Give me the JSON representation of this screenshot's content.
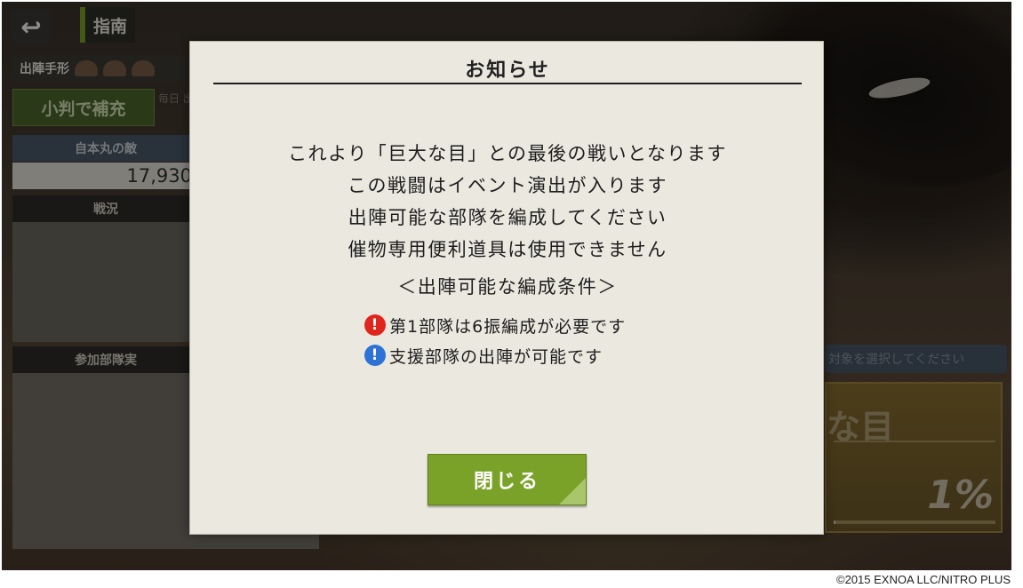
{
  "hud": {
    "back_icon": "↩",
    "guide_label": "指南",
    "tegata_label": "出陣手形",
    "refill_label": "小判で補充",
    "refill_note": "毎日 出陣",
    "enemy_header": "自本丸の敵",
    "enemy_count": "17,930",
    "situation_header": "戦況",
    "party_header": "参加部隊実"
  },
  "right_panel": {
    "select_hint": "対象を選択してください",
    "boss_name": "な目",
    "boss_percent": "1%",
    "boss_progress": 0.01
  },
  "modal": {
    "title": "お知らせ",
    "lines": [
      "これより「巨大な目」との最後の戦いとなります",
      "この戦闘はイベント演出が入ります",
      "出陣可能な部隊を編成してください",
      "催物専用便利道具は使用できません"
    ],
    "conditions_header": "＜出陣可能な編成条件＞",
    "conditions": [
      {
        "text": "第1部隊は6振編成が必要です",
        "icon": "red-exclamation-icon",
        "color": "#e0261c"
      },
      {
        "text": "支援部隊の出陣が可能です",
        "icon": "blue-exclamation-icon",
        "color": "#2f72d6"
      }
    ],
    "close_label": "閉じる",
    "accent_color": "#7aa228"
  },
  "footer": {
    "copyright": "©2015 EXNOA LLC/NITRO PLUS"
  }
}
